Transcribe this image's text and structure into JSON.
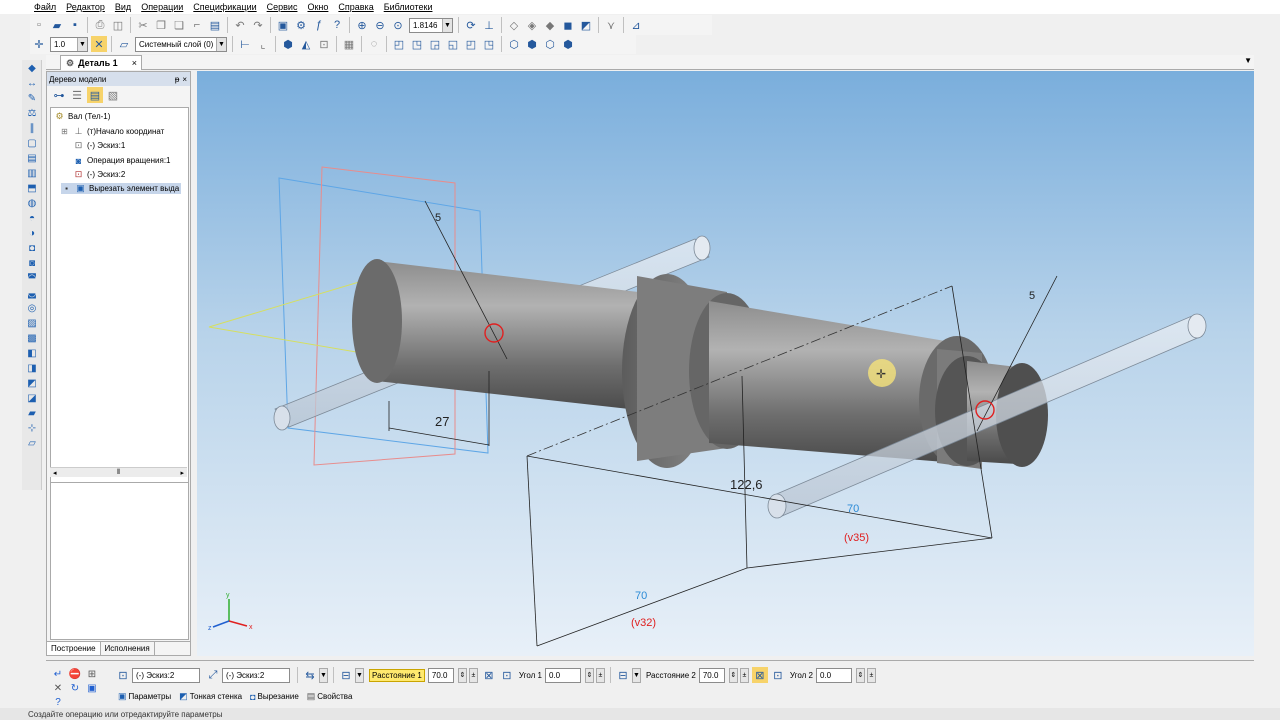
{
  "menu": [
    "Файл",
    "Редактор",
    "Вид",
    "Операции",
    "Спецификации",
    "Сервис",
    "Окно",
    "Справка",
    "Библиотеки"
  ],
  "toolbar": {
    "zoom_value": "1.8146",
    "step_value": "1.0",
    "layer_value": "Системный слой (0)"
  },
  "document_tab": {
    "label": "Деталь 1",
    "close": "×"
  },
  "tree": {
    "title": "Дерево модели",
    "pin": "ᵽ",
    "close": "×",
    "nodes": [
      {
        "label": "Вал (Тел-1)"
      },
      {
        "label": "(т)Начало координат"
      },
      {
        "label": "(-) Эскиз:1"
      },
      {
        "label": "Операция вращения:1"
      },
      {
        "label": "(-) Эскиз:2"
      },
      {
        "label": "Вырезать элемент выда"
      }
    ],
    "tabs": [
      "Построение",
      "Исполнения"
    ]
  },
  "viewport": {
    "dim_27": "27",
    "dim_1226": "122,6",
    "dim_70a": "70",
    "dim_v35": "(v35)",
    "dim_70b": "70",
    "dim_v32": "(v32)",
    "angle_5a": "5",
    "angle_5b": "5",
    "axis_x": "x",
    "axis_y": "y",
    "axis_z": "z"
  },
  "properties": {
    "sketch1": "(-) Эскиз:2",
    "sketch2": "(-) Эскиз:2",
    "distance1_label": "Расстояние 1",
    "distance1_value": "70.0",
    "angle1_label": "Угол 1",
    "angle1_value": "0.0",
    "distance2_label": "Расстояние 2",
    "distance2_value": "70.0",
    "angle2_label": "Угол 2",
    "angle2_value": "0.0",
    "tabs": [
      "Параметры",
      "Тонкая стенка",
      "Вырезание",
      "Свойства"
    ]
  },
  "status": "Создайте операцию или отредактируйте параметры"
}
